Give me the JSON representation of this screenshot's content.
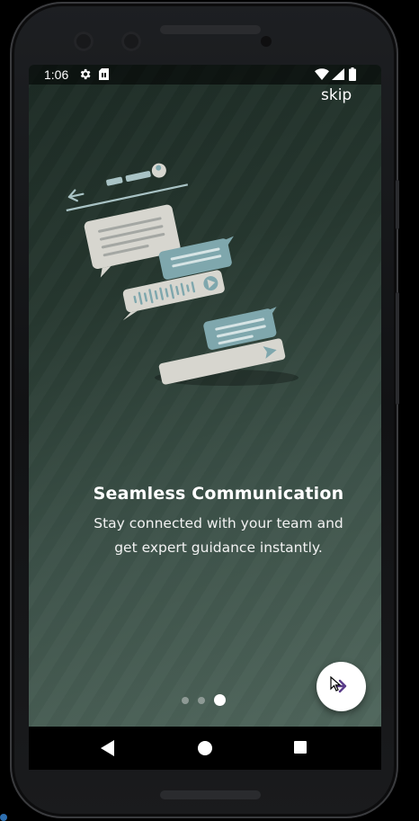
{
  "status_bar": {
    "time": "1:06",
    "icons": [
      "gear-icon",
      "sim-card-icon",
      "wifi-icon",
      "signal-icon",
      "battery-icon"
    ]
  },
  "onboarding": {
    "skip_label": "skip",
    "title": "Seamless Communication",
    "description_lines": [
      "Stay connected with your team and",
      "get expert guidance instantly."
    ],
    "page_indicator": {
      "total": 3,
      "active": 3
    },
    "next_button_icon": "arrow-right-icon"
  },
  "navigation_bar": {
    "buttons": [
      "back-icon",
      "home-icon",
      "recents-icon"
    ]
  },
  "colors": {
    "background_dark": "#1c2a24",
    "background_light": "#52695f",
    "bubble_light": "#d7d6cf",
    "bubble_teal": "#7fa7ad",
    "dot_inactive": "#8e9a95",
    "dot_active": "#ffffff",
    "fab_arrow": "#5a3d8a"
  }
}
